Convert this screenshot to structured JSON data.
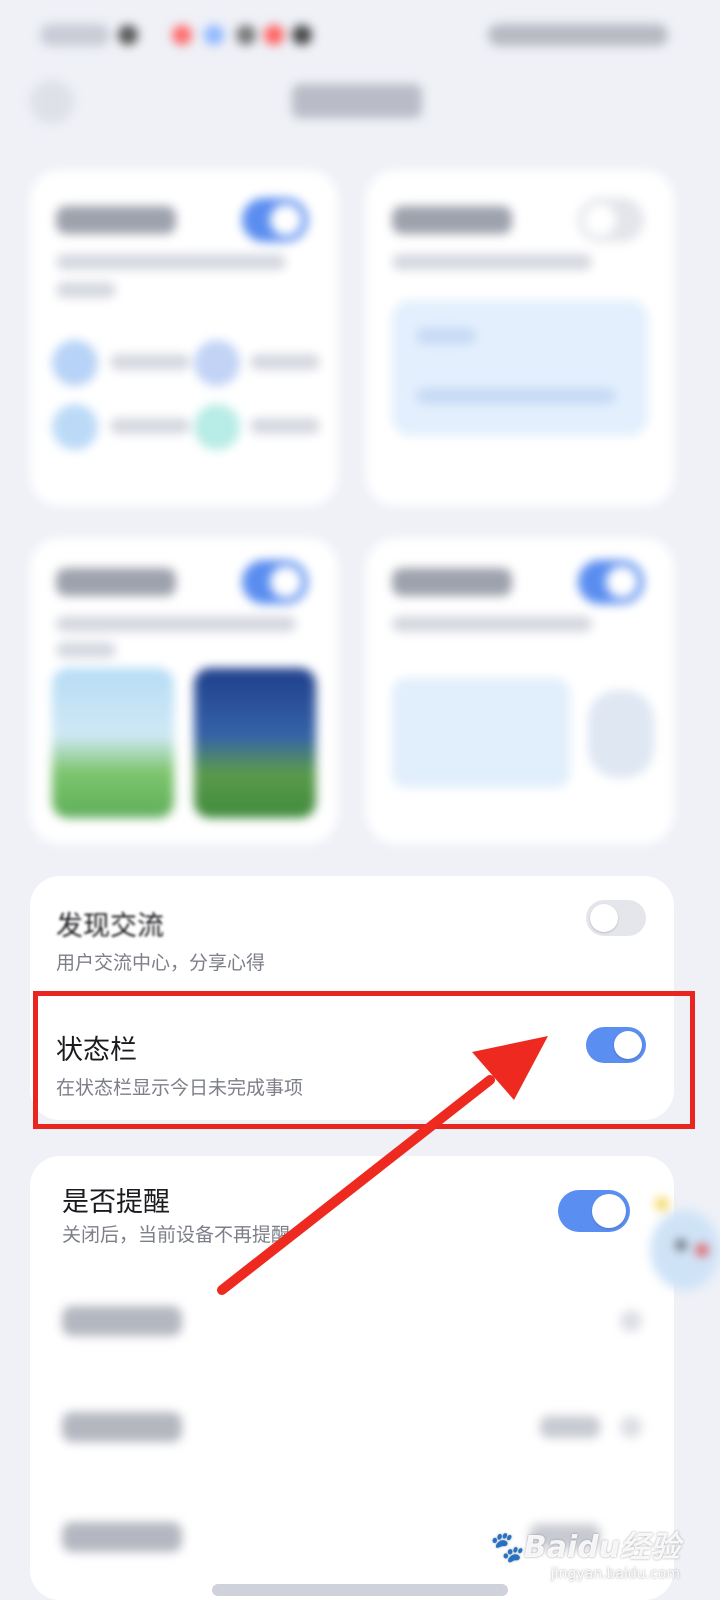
{
  "settings": {
    "discover": {
      "title": "发现交流",
      "subtitle": "用户交流中心，分享心得",
      "enabled": false
    },
    "status_bar": {
      "title": "状态栏",
      "subtitle": "在状态栏显示今日未完成事项",
      "enabled": true
    },
    "reminder": {
      "title": "是否提醒",
      "subtitle": "关闭后，当前设备不再提醒",
      "enabled": true
    }
  },
  "watermark": {
    "brand": "Baidu经验",
    "url": "jingyan.baidu.com"
  },
  "colors": {
    "accent": "#5b8ef1",
    "highlight": "#e8251e",
    "background": "#eff1f7"
  },
  "icons": [
    "back-icon",
    "mascot-icon",
    "baidu-paw-icon"
  ]
}
